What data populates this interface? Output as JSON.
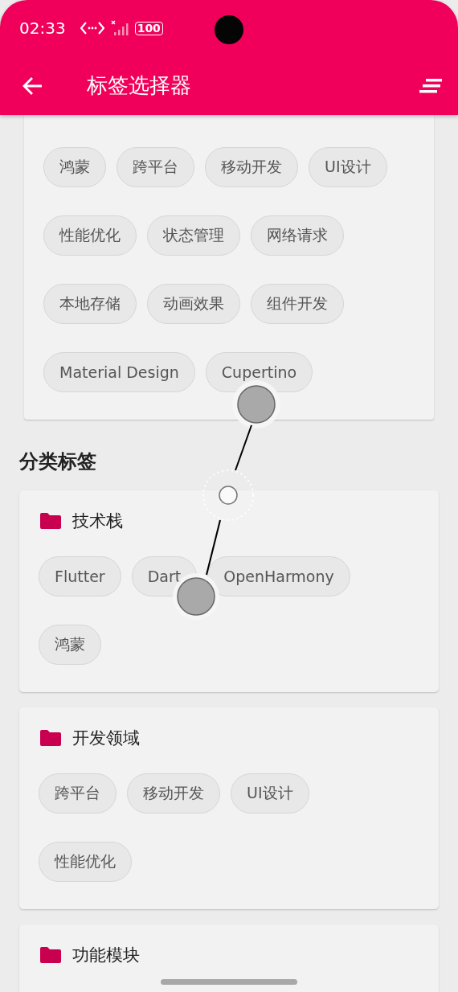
{
  "status_bar": {
    "time": "02:33",
    "battery": "100"
  },
  "app_bar": {
    "title": "标签选择器"
  },
  "tag_card": {
    "tags": [
      {
        "label": "鸿蒙",
        "selected": false
      },
      {
        "label": "跨平台",
        "selected": false
      },
      {
        "label": "移动开发",
        "selected": false
      },
      {
        "label": "UI设计",
        "selected": false
      },
      {
        "label": "性能优化",
        "selected": false
      },
      {
        "label": "状态管理",
        "selected": false
      },
      {
        "label": "网络请求",
        "selected": false
      },
      {
        "label": "本地存储",
        "selected": false
      },
      {
        "label": "动画效果",
        "selected": false
      },
      {
        "label": "组件开发",
        "selected": false
      },
      {
        "label": "Material Design",
        "selected": false
      },
      {
        "label": "Cupertino",
        "selected": false
      }
    ]
  },
  "section_title": "分类标签",
  "categories": [
    {
      "name": "技术栈",
      "tags": [
        {
          "label": "Flutter",
          "selected": false
        },
        {
          "label": "Dart",
          "selected": false
        },
        {
          "label": "OpenHarmony",
          "selected": false
        },
        {
          "label": "鸿蒙",
          "selected": false
        }
      ]
    },
    {
      "name": "开发领域",
      "tags": [
        {
          "label": "跨平台",
          "selected": false
        },
        {
          "label": "移动开发",
          "selected": false
        },
        {
          "label": "UI设计",
          "selected": false
        },
        {
          "label": "性能优化",
          "selected": false
        }
      ]
    },
    {
      "name": "功能模块"
    }
  ]
}
